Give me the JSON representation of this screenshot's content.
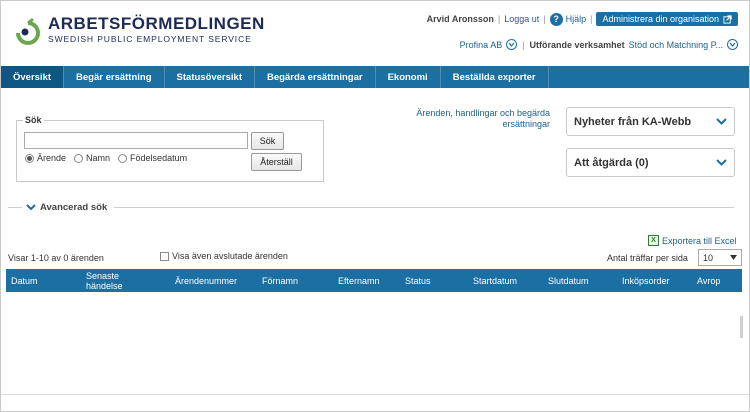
{
  "header": {
    "logo_name": "ARBETSFÖRMEDLINGEN",
    "logo_tagline": "SWEDISH PUBLIC EMPLOYMENT SERVICE",
    "logo_icon": "af-logo-icon",
    "user_name": "Arvid Aronsson",
    "logout_label": "Logga ut",
    "help_label": "Hjälp",
    "admin_label": "Administrera din organisation",
    "org_name": "Profina AB",
    "exec_label": "Utförande verksamhet",
    "exec_value": "Stöd och Matchning P..."
  },
  "nav": {
    "items": [
      {
        "label": "Översikt"
      },
      {
        "label": "Begär ersättning"
      },
      {
        "label": "Statusöversikt"
      },
      {
        "label": "Begärda ersättningar"
      },
      {
        "label": "Ekonomi"
      },
      {
        "label": "Beställda exporter"
      }
    ]
  },
  "search": {
    "legend": "Sök",
    "input_value": "",
    "search_button": "Sök",
    "reset_button": "Återställ",
    "radios": [
      {
        "label": "Ärende",
        "checked": true
      },
      {
        "label": "Namn",
        "checked": false
      },
      {
        "label": "Födelsedatum",
        "checked": false
      }
    ]
  },
  "links": {
    "cases_link": "Ärenden, handlingar och begärda ersättningar"
  },
  "panels": {
    "news": "Nyheter från KA-Webb",
    "actions": "Att åtgärda (0)"
  },
  "advanced": {
    "label": "Avancerad sök"
  },
  "results": {
    "showing": "Visar 1-10 av 0 ärenden",
    "show_closed": "Visa även avslutade ärenden",
    "export_label": "Exportera till Excel",
    "per_page_label": "Antal träffar per sida",
    "per_page_value": "10"
  },
  "table": {
    "columns": [
      "Datum",
      "Senaste händelse",
      "Ärendenummer",
      "Förnamn",
      "Efternamn",
      "Status",
      "Startdatum",
      "Slutdatum",
      "Inköpsorder",
      "Avrop"
    ],
    "rows": []
  },
  "colors": {
    "brand_blue": "#1c6fa3",
    "logo_navy": "#1c2a57",
    "logo_green": "#6aa84f"
  }
}
